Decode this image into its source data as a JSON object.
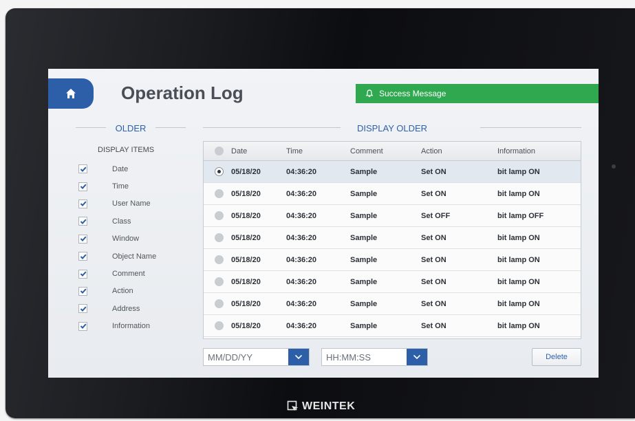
{
  "header": {
    "title": "Operation Log",
    "success_message": "Success Message"
  },
  "left_panel": {
    "section_title": "OLDER",
    "display_items_label": "DISPLAY ITEMS",
    "items": [
      {
        "label": "Date",
        "checked": true
      },
      {
        "label": "Time",
        "checked": true
      },
      {
        "label": "User Name",
        "checked": true
      },
      {
        "label": "Class",
        "checked": true
      },
      {
        "label": "Window",
        "checked": true
      },
      {
        "label": "Object Name",
        "checked": true
      },
      {
        "label": "Comment",
        "checked": true
      },
      {
        "label": "Action",
        "checked": true
      },
      {
        "label": "Address",
        "checked": true
      },
      {
        "label": "Information",
        "checked": true
      }
    ]
  },
  "table": {
    "section_title": "DISPLAY OLDER",
    "columns": [
      "Date",
      "Time",
      "Comment",
      "Action",
      "Information"
    ],
    "rows": [
      {
        "selected": true,
        "date": "05/18/20",
        "time": "04:36:20",
        "comment": "Sample",
        "action": "Set ON",
        "information": "bit lamp ON"
      },
      {
        "selected": false,
        "date": "05/18/20",
        "time": "04:36:20",
        "comment": "Sample",
        "action": "Set ON",
        "information": "bit lamp ON"
      },
      {
        "selected": false,
        "date": "05/18/20",
        "time": "04:36:20",
        "comment": "Sample",
        "action": "Set OFF",
        "information": "bit lamp OFF"
      },
      {
        "selected": false,
        "date": "05/18/20",
        "time": "04:36:20",
        "comment": "Sample",
        "action": "Set ON",
        "information": "bit lamp ON"
      },
      {
        "selected": false,
        "date": "05/18/20",
        "time": "04:36:20",
        "comment": "Sample",
        "action": "Set ON",
        "information": "bit lamp ON"
      },
      {
        "selected": false,
        "date": "05/18/20",
        "time": "04:36:20",
        "comment": "Sample",
        "action": "Set ON",
        "information": "bit lamp ON"
      },
      {
        "selected": false,
        "date": "05/18/20",
        "time": "04:36:20",
        "comment": "Sample",
        "action": "Set ON",
        "information": "bit lamp ON"
      },
      {
        "selected": false,
        "date": "05/18/20",
        "time": "04:36:20",
        "comment": "Sample",
        "action": "Set ON",
        "information": "bit lamp ON"
      }
    ]
  },
  "controls": {
    "date_value": "MM/DD/YY",
    "time_value": "HH:MM:SS",
    "delete_label": "Delete"
  },
  "device": {
    "brand": "WEINTEK"
  },
  "colors": {
    "accent": "#2d5ea8",
    "success": "#2fa84f",
    "bezel": "#141519"
  },
  "icons": {
    "home": "home-icon",
    "bell": "bell-icon",
    "checkbox": "check-icon",
    "dropdown": "chevron-down-icon",
    "brand_logo": "weintek-logo-icon"
  }
}
